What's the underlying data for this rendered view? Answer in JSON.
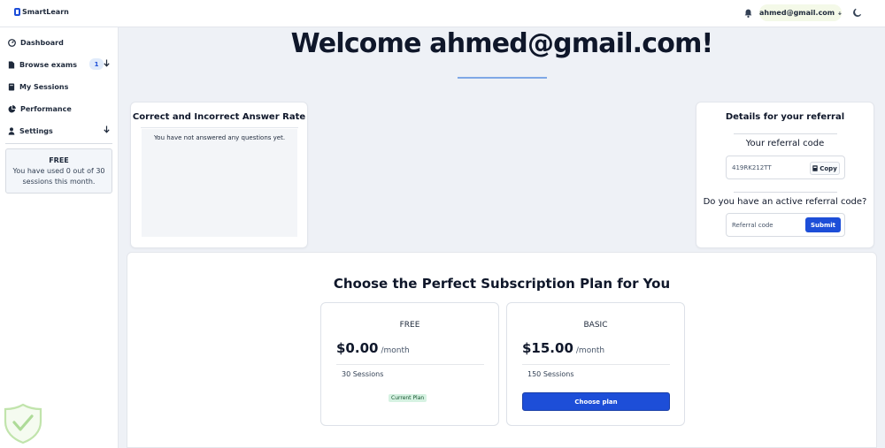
{
  "app": {
    "logo_text": "SmartLearn"
  },
  "header": {
    "user_email": "ahmed@gmail.com"
  },
  "sidebar": {
    "items": [
      {
        "label": "Dashboard",
        "icon": "gauge-icon"
      },
      {
        "label": "Browse exams",
        "icon": "file-icon",
        "badge": "1"
      },
      {
        "label": "My Sessions",
        "icon": "book-icon"
      },
      {
        "label": "Performance",
        "icon": "pie-icon"
      },
      {
        "label": "Settings",
        "icon": "person-icon"
      }
    ],
    "plan_box": {
      "title": "FREE",
      "text": "You have used 0 out of 30 sessions this month."
    }
  },
  "main": {
    "welcome": "Welcome ahmed@gmail.com!",
    "answer_rate": {
      "title": "Correct and Incorrect Answer Rate",
      "empty_text": "You have not answered any questions yet."
    },
    "referral": {
      "title": "Details for your referral",
      "code_label": "Your referral code",
      "code": "419RK212TT",
      "copy_label": "Copy",
      "active_question": "Do you have an active referral code?",
      "input_placeholder": "Referral code",
      "submit_label": "Submit"
    },
    "plans": {
      "title": "Choose the Perfect Subscription Plan for You",
      "items": [
        {
          "name": "FREE",
          "price": "$0.00",
          "period": "/month",
          "sessions": "30  Sessions",
          "badge": "Current Plan"
        },
        {
          "name": "BASIC",
          "price": "$15.00",
          "period": "/month",
          "sessions": "150  Sessions",
          "button": "Choose plan"
        }
      ]
    }
  },
  "colors": {
    "accent": "#1d4ed8",
    "background": "#eef1f6",
    "badge_green": "#d6f2e2"
  }
}
